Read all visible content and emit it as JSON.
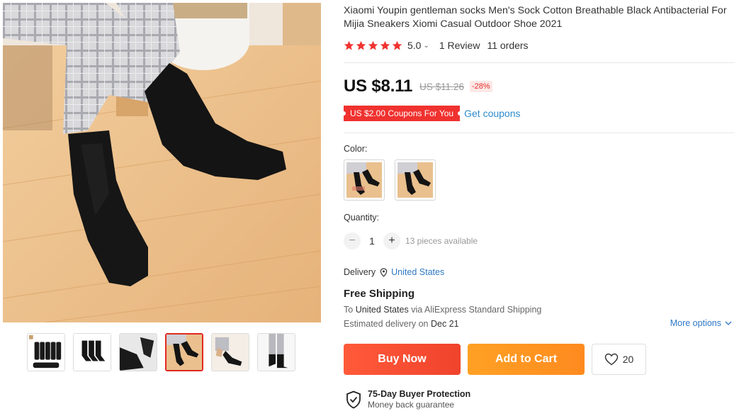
{
  "product": {
    "title": "Xiaomi Youpin gentleman socks Men's Sock Cotton Breathable Black Antibacterial For Mijia Sneakers Xiomi Casual Outdoor Shoe 2021",
    "rating": "5.0",
    "stars": 5,
    "reviews": "1 Review",
    "orders": "11 orders"
  },
  "price": {
    "current": "US $8.11",
    "original": "US $11.26",
    "discount": "-28%"
  },
  "coupon": {
    "tag": "US $2.00 Coupons For You",
    "link": "Get coupons"
  },
  "color": {
    "label": "Color:",
    "options": [
      "black-socks-variant-1",
      "black-socks-variant-2"
    ]
  },
  "quantity": {
    "label": "Quantity:",
    "minus": "−",
    "value": "1",
    "plus": "+",
    "available": "13 pieces available"
  },
  "delivery": {
    "label": "Delivery",
    "country": "United States",
    "shipping_title": "Free Shipping",
    "ship_to_prefix": "To",
    "ship_to_country": "United States",
    "ship_via": "via AliExpress Standard Shipping",
    "estimate_prefix": "Estimated delivery on",
    "estimate_date": "Dec 21",
    "more_options": "More options"
  },
  "actions": {
    "buy_now": "Buy Now",
    "add_to_cart": "Add to Cart",
    "wishlist_count": "20"
  },
  "protection": {
    "title": "75-Day Buyer Protection",
    "subtitle": "Money back guarantee"
  },
  "gallery": {
    "thumbnails": [
      "socks-set-packaged",
      "socks-five-pairs",
      "socks-worn-closeup",
      "socks-on-floor",
      "socks-putting-on",
      "socks-standing"
    ],
    "active_index": 3
  },
  "colors": {
    "star": "#f0322f",
    "price_red": "#f0322f",
    "link_blue": "#2e8bcd",
    "buy_now": "#f0432c",
    "add_to_cart": "#ff9a22"
  }
}
